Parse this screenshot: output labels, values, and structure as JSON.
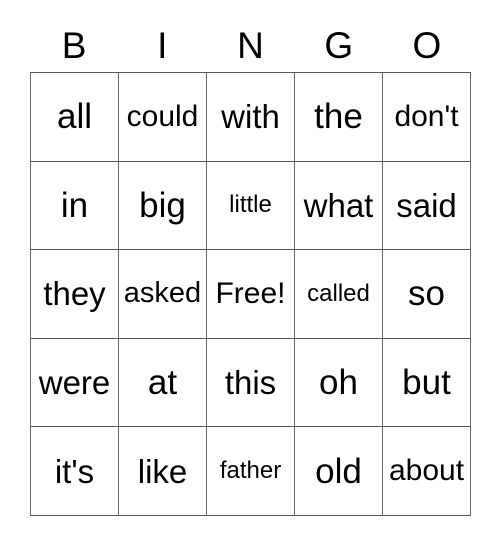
{
  "card": {
    "title": "BINGO",
    "free_space_label": "Free!",
    "text_color": "#000000",
    "background_color": "#ffffff",
    "grid_line_color": "#666666",
    "columns": 5,
    "rows": 5
  },
  "header": {
    "letters": [
      "B",
      "I",
      "N",
      "G",
      "O"
    ]
  },
  "grid": {
    "rows": [
      [
        "all",
        "could",
        "with",
        "the",
        "don't"
      ],
      [
        "in",
        "big",
        "little",
        "what",
        "said"
      ],
      [
        "they",
        "asked",
        "Free!",
        "called",
        "so"
      ],
      [
        "were",
        "at",
        "this",
        "oh",
        "but"
      ],
      [
        "it's",
        "like",
        "father",
        "old",
        "about"
      ]
    ]
  }
}
